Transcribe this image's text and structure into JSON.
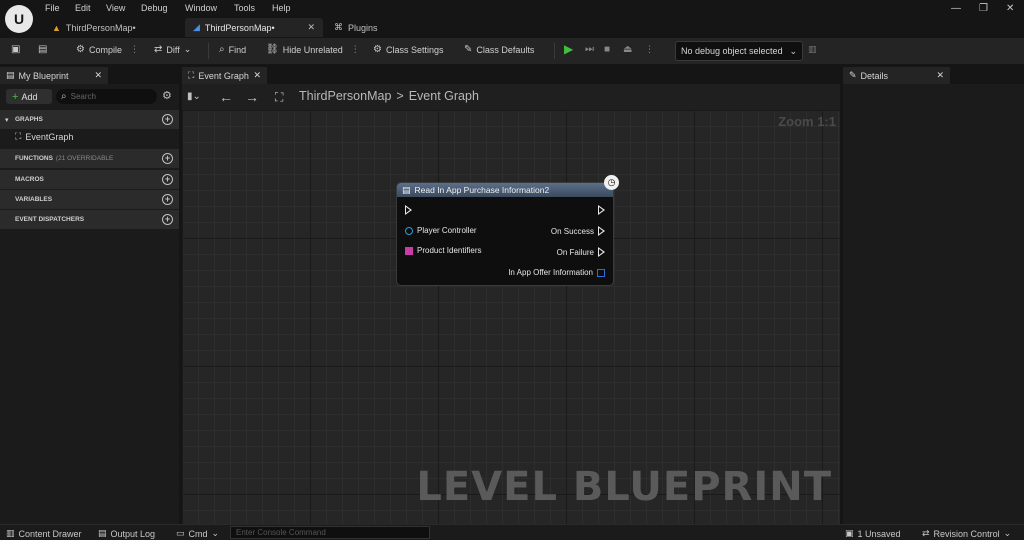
{
  "menu": [
    "File",
    "Edit",
    "View",
    "Debug",
    "Window",
    "Tools",
    "Help"
  ],
  "tabs": [
    {
      "label": "ThirdPersonMap•",
      "active": false
    },
    {
      "label": "ThirdPersonMap•",
      "active": true
    },
    {
      "label": "Plugins",
      "active": false
    }
  ],
  "toolbar": {
    "compile": "Compile",
    "diff": "Diff",
    "find": "Find",
    "hide_unrelated": "Hide Unrelated",
    "class_settings": "Class Settings",
    "class_defaults": "Class Defaults",
    "debug_object": "No debug object selected"
  },
  "left_panel": {
    "tab": "My Blueprint",
    "add": "Add",
    "search_placeholder": "Search",
    "sections": [
      {
        "label": "GRAPHS",
        "sub": ""
      },
      {
        "label": "FUNCTIONS",
        "sub": "(21 OVERRIDABLE"
      },
      {
        "label": "MACROS",
        "sub": ""
      },
      {
        "label": "VARIABLES",
        "sub": ""
      },
      {
        "label": "EVENT DISPATCHERS",
        "sub": ""
      }
    ],
    "graph_item": "EventGraph"
  },
  "graph": {
    "tab": "Event Graph",
    "breadcrumb_root": "ThirdPersonMap",
    "breadcrumb_sep": ">",
    "breadcrumb_leaf": "Event Graph",
    "zoom": "Zoom 1:1",
    "watermark": "LEVEL BLUEPRINT",
    "node": {
      "title": "Read In App Purchase Information2",
      "pins_in": [
        "Player Controller",
        "Product Identifiers"
      ],
      "pins_out": [
        "On Success",
        "On Failure",
        "In App Offer Information"
      ]
    }
  },
  "details": {
    "tab": "Details"
  },
  "status": {
    "content_drawer": "Content Drawer",
    "output_log": "Output Log",
    "cmd": "Cmd",
    "console_placeholder": "Enter Console Command",
    "unsaved": "1 Unsaved",
    "revision": "Revision Control"
  },
  "colors": {
    "accent_play": "#3fbf3f",
    "node_header": "#4a5d75",
    "object_pin": "#2aa0d8",
    "array_pin": "#c83ca8"
  }
}
